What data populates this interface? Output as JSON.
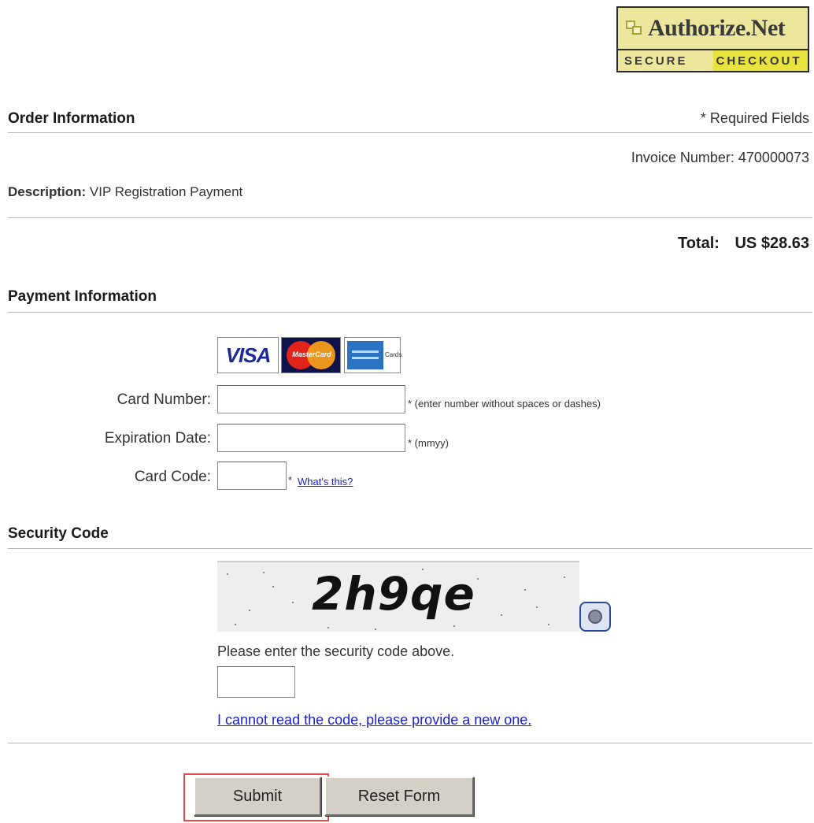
{
  "badge": {
    "brand": "Authorize.Net",
    "secure": "SECURE",
    "checkout": "CHECKOUT"
  },
  "order": {
    "title": "Order Information",
    "required_note": "* Required Fields",
    "invoice": "Invoice Number: 470000073",
    "description_label": "Description:",
    "description_value": "VIP Registration Payment",
    "total_label": "Total:",
    "total_value": "US $28.63"
  },
  "payment": {
    "title": "Payment Information",
    "cards": {
      "visa": "VISA",
      "mastercard": "MasterCard",
      "amex_text": "Cards"
    },
    "card_number_label": "Card Number:",
    "card_number_hint": "* (enter number without spaces or dashes)",
    "card_number_value": "",
    "expiration_label": "Expiration Date:",
    "expiration_hint": "* (mmyy)",
    "expiration_value": "",
    "card_code_label": "Card Code:",
    "card_code_star": "*",
    "card_code_link": "What's this?",
    "card_code_value": ""
  },
  "security": {
    "title": "Security Code",
    "captcha_text": "2h9qe",
    "instruction": "Please enter the security code above.",
    "code_value": "",
    "new_code_link": "I cannot read the code, please provide a new one."
  },
  "actions": {
    "submit": "Submit",
    "reset": "Reset Form"
  },
  "icons": {
    "refresh": "refresh-captcha-icon",
    "logo": "authorize-net-logo-icon"
  },
  "colors": {
    "link": "#1a22c8",
    "badge_bg": "#ece79c",
    "highlight": "#e04c4c"
  }
}
